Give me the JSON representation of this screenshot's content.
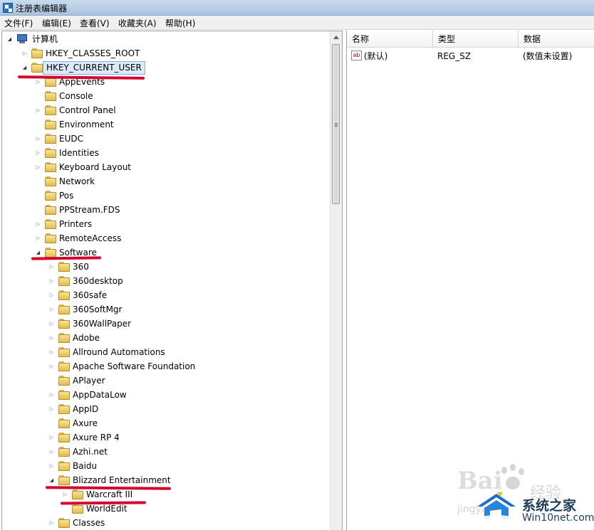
{
  "window": {
    "title": "注册表编辑器"
  },
  "menu": [
    "文件(F)",
    "编辑(E)",
    "查看(V)",
    "收藏夹(A)",
    "帮助(H)"
  ],
  "tree": {
    "root": "计算机",
    "hives": [
      "HKEY_CLASSES_ROOT",
      "HKEY_CURRENT_USER"
    ],
    "current_user_keys": [
      "AppEvents",
      "Console",
      "Control Panel",
      "Environment",
      "EUDC",
      "Identities",
      "Keyboard Layout",
      "Network",
      "Pos",
      "PPStream.FDS",
      "Printers",
      "RemoteAccess",
      "Software"
    ],
    "software_keys": [
      "360",
      "360desktop",
      "360safe",
      "360SoftMgr",
      "360WallPaper",
      "Adobe",
      "Allround Automations",
      "Apache Software Foundation",
      "APlayer",
      "AppDataLow",
      "AppID",
      "Axure",
      "Axure RP 4",
      "Azhi.net",
      "Baidu",
      "Blizzard Entertainment"
    ],
    "blizzard_keys": [
      "Warcraft III",
      "WorldEdit"
    ],
    "after_blizzard": [
      "Classes"
    ]
  },
  "list": {
    "columns": [
      "名称",
      "类型",
      "数据"
    ],
    "rows": [
      {
        "icon": "ab",
        "name": "(默认)",
        "type": "REG_SZ",
        "data": "(数值未设置)"
      }
    ]
  },
  "watermark": {
    "baidu": "Bai",
    "baidu_suffix": "经验",
    "baidu_sub": "jingyan",
    "site_name": "系统之家",
    "site_url": "Win10net.com"
  },
  "colors": {
    "annotation_red": "#d3082f",
    "selection": "#dce9f7"
  }
}
